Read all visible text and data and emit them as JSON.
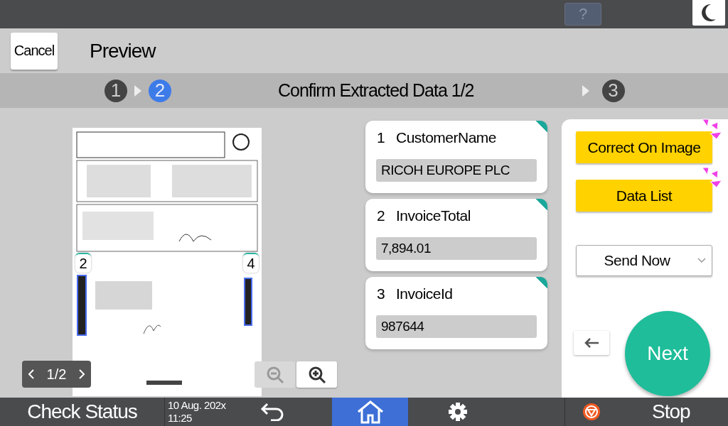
{
  "top_bar": {
    "help": "?"
  },
  "header": {
    "cancel": "Cancel",
    "title": "Preview"
  },
  "steps": [
    {
      "label": "1",
      "selected": false
    },
    {
      "label": "2",
      "selected": true
    },
    {
      "label": "3",
      "selected": false
    }
  ],
  "step_title": "Confirm Extracted Data 1/2",
  "preview": {
    "region_markers": [
      "2",
      "4"
    ],
    "pager": "1/2",
    "zoom_out": {
      "disabled": true
    },
    "zoom_in": {
      "disabled": false
    }
  },
  "fields": [
    {
      "index": "1",
      "name": "CustomerName",
      "value": "RICOH EUROPE PLC"
    },
    {
      "index": "2",
      "name": "InvoiceTotal",
      "value": "7,894.01"
    },
    {
      "index": "3",
      "name": "InvoiceId",
      "value": "987644"
    }
  ],
  "actions": {
    "buttons": [
      "Correct On Image",
      "Data List"
    ],
    "dropdown": "Send Now",
    "next": "Next"
  },
  "bottom_bar": {
    "check_status": "Check Status",
    "date": "10 Aug. 202x",
    "time": "11:25",
    "stop": "Stop"
  }
}
